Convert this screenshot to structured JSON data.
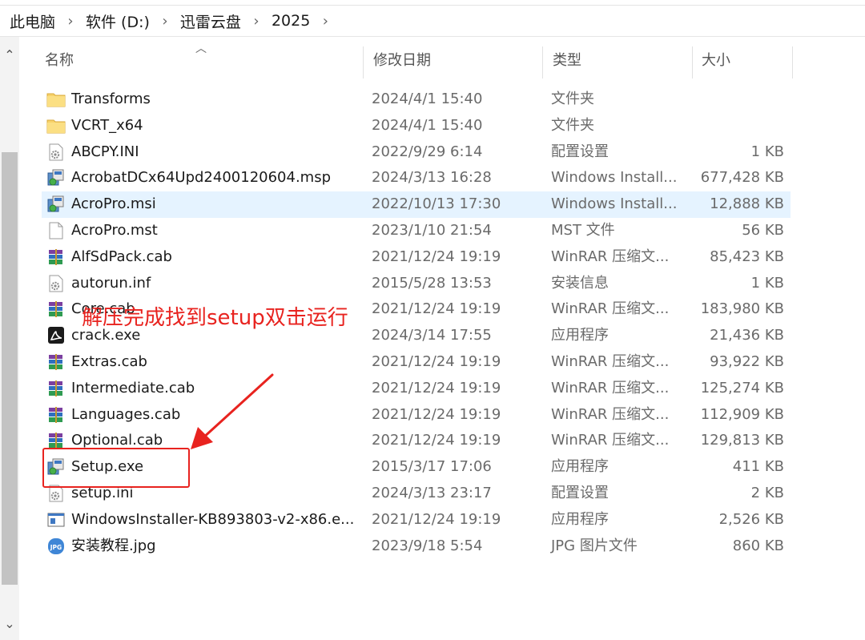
{
  "breadcrumb": [
    "此电脑",
    "软件 (D:)",
    "迅雷云盘",
    "2025"
  ],
  "columns": {
    "name": "名称",
    "date": "修改日期",
    "type": "类型",
    "size": "大小"
  },
  "files": [
    {
      "name": "Transforms",
      "date": "2024/4/1 15:40",
      "type": "文件夹",
      "size": "",
      "icon": "folder-icon"
    },
    {
      "name": "VCRT_x64",
      "date": "2024/4/1 15:40",
      "type": "文件夹",
      "size": "",
      "icon": "folder-icon"
    },
    {
      "name": "ABCPY.INI",
      "date": "2022/9/29 6:14",
      "type": "配置设置",
      "size": "1 KB",
      "icon": "settings-file-icon"
    },
    {
      "name": "AcrobatDCx64Upd2400120604.msp",
      "date": "2024/3/13 16:28",
      "type": "Windows Install...",
      "size": "677,428 KB",
      "icon": "installer-icon"
    },
    {
      "name": "AcroPro.msi",
      "date": "2022/10/13 17:30",
      "type": "Windows Install...",
      "size": "12,888 KB",
      "icon": "installer-icon",
      "selected": true
    },
    {
      "name": "AcroPro.mst",
      "date": "2023/1/10 21:54",
      "type": "MST 文件",
      "size": "56 KB",
      "icon": "blank-file-icon"
    },
    {
      "name": "AlfSdPack.cab",
      "date": "2021/12/24 19:19",
      "type": "WinRAR 压缩文...",
      "size": "85,423 KB",
      "icon": "winrar-icon"
    },
    {
      "name": "autorun.inf",
      "date": "2015/5/28 13:53",
      "type": "安装信息",
      "size": "1 KB",
      "icon": "settings-file-icon"
    },
    {
      "name": "Core.cab",
      "date": "2021/12/24 19:19",
      "type": "WinRAR 压缩文...",
      "size": "183,980 KB",
      "icon": "winrar-icon"
    },
    {
      "name": "crack.exe",
      "date": "2024/3/14 17:55",
      "type": "应用程序",
      "size": "21,436 KB",
      "icon": "acrobat-icon"
    },
    {
      "name": "Extras.cab",
      "date": "2021/12/24 19:19",
      "type": "WinRAR 压缩文...",
      "size": "93,922 KB",
      "icon": "winrar-icon"
    },
    {
      "name": "Intermediate.cab",
      "date": "2021/12/24 19:19",
      "type": "WinRAR 压缩文...",
      "size": "125,274 KB",
      "icon": "winrar-icon"
    },
    {
      "name": "Languages.cab",
      "date": "2021/12/24 19:19",
      "type": "WinRAR 压缩文...",
      "size": "112,909 KB",
      "icon": "winrar-icon"
    },
    {
      "name": "Optional.cab",
      "date": "2021/12/24 19:19",
      "type": "WinRAR 压缩文...",
      "size": "129,813 KB",
      "icon": "winrar-icon"
    },
    {
      "name": "Setup.exe",
      "date": "2015/3/17 17:06",
      "type": "应用程序",
      "size": "411 KB",
      "icon": "installer-icon"
    },
    {
      "name": "setup.ini",
      "date": "2024/3/13 23:17",
      "type": "配置设置",
      "size": "2 KB",
      "icon": "settings-file-icon"
    },
    {
      "name": "WindowsInstaller-KB893803-v2-x86.e...",
      "date": "2021/12/24 19:19",
      "type": "应用程序",
      "size": "2,526 KB",
      "icon": "window-app-icon"
    },
    {
      "name": "安装教程.jpg",
      "date": "2023/9/18 5:54",
      "type": "JPG 图片文件",
      "size": "860 KB",
      "icon": "jpg-icon"
    }
  ],
  "annotation": {
    "text": "解压完成找到setup双击运行",
    "color": "#e8231f"
  },
  "colors": {
    "selection": "#e5f3ff",
    "accent_red": "#e8231f",
    "folder": "#f7d26a"
  }
}
